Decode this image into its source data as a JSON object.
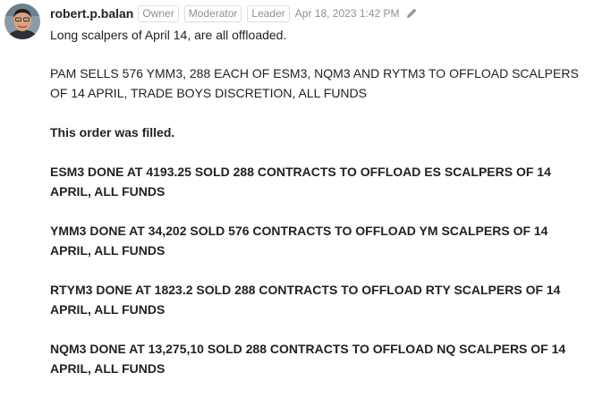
{
  "post": {
    "author": {
      "username": "robert.p.balan",
      "avatar_icon": "user-avatar"
    },
    "badges": [
      "Owner",
      "Moderator",
      "Leader"
    ],
    "date": "Apr 18, 2023 1:42 PM",
    "edit_icon": "pencil-icon",
    "paragraphs": [
      "Long scalpers of April 14, are all offloaded.",
      "PAM SELLS 576 YMM3, 288 EACH OF ESM3, NQM3 AND RYTM3 TO OFFLOAD SCALPERS OF 14 APRIL, TRADE BOYS DISCRETION, ALL FUNDS",
      "This order was filled.",
      "ESM3 DONE AT 4193.25 SOLD 288 CONTRACTS TO OFFLOAD ES SCALPERS OF 14 APRIL, ALL FUNDS",
      "YMM3 DONE AT 34,202 SOLD 576 CONTRACTS TO OFFLOAD YM SCALPERS OF 14 APRIL, ALL FUNDS",
      "RTYM3 DONE AT 1823.2 SOLD 288 CONTRACTS TO OFFLOAD RTY SCALPERS OF 14 APRIL, ALL FUNDS",
      "NQM3 DONE AT 13,275,10 SOLD 288 CONTRACTS TO OFFLOAD NQ SCALPERS OF 14 APRIL, ALL FUNDS"
    ]
  }
}
